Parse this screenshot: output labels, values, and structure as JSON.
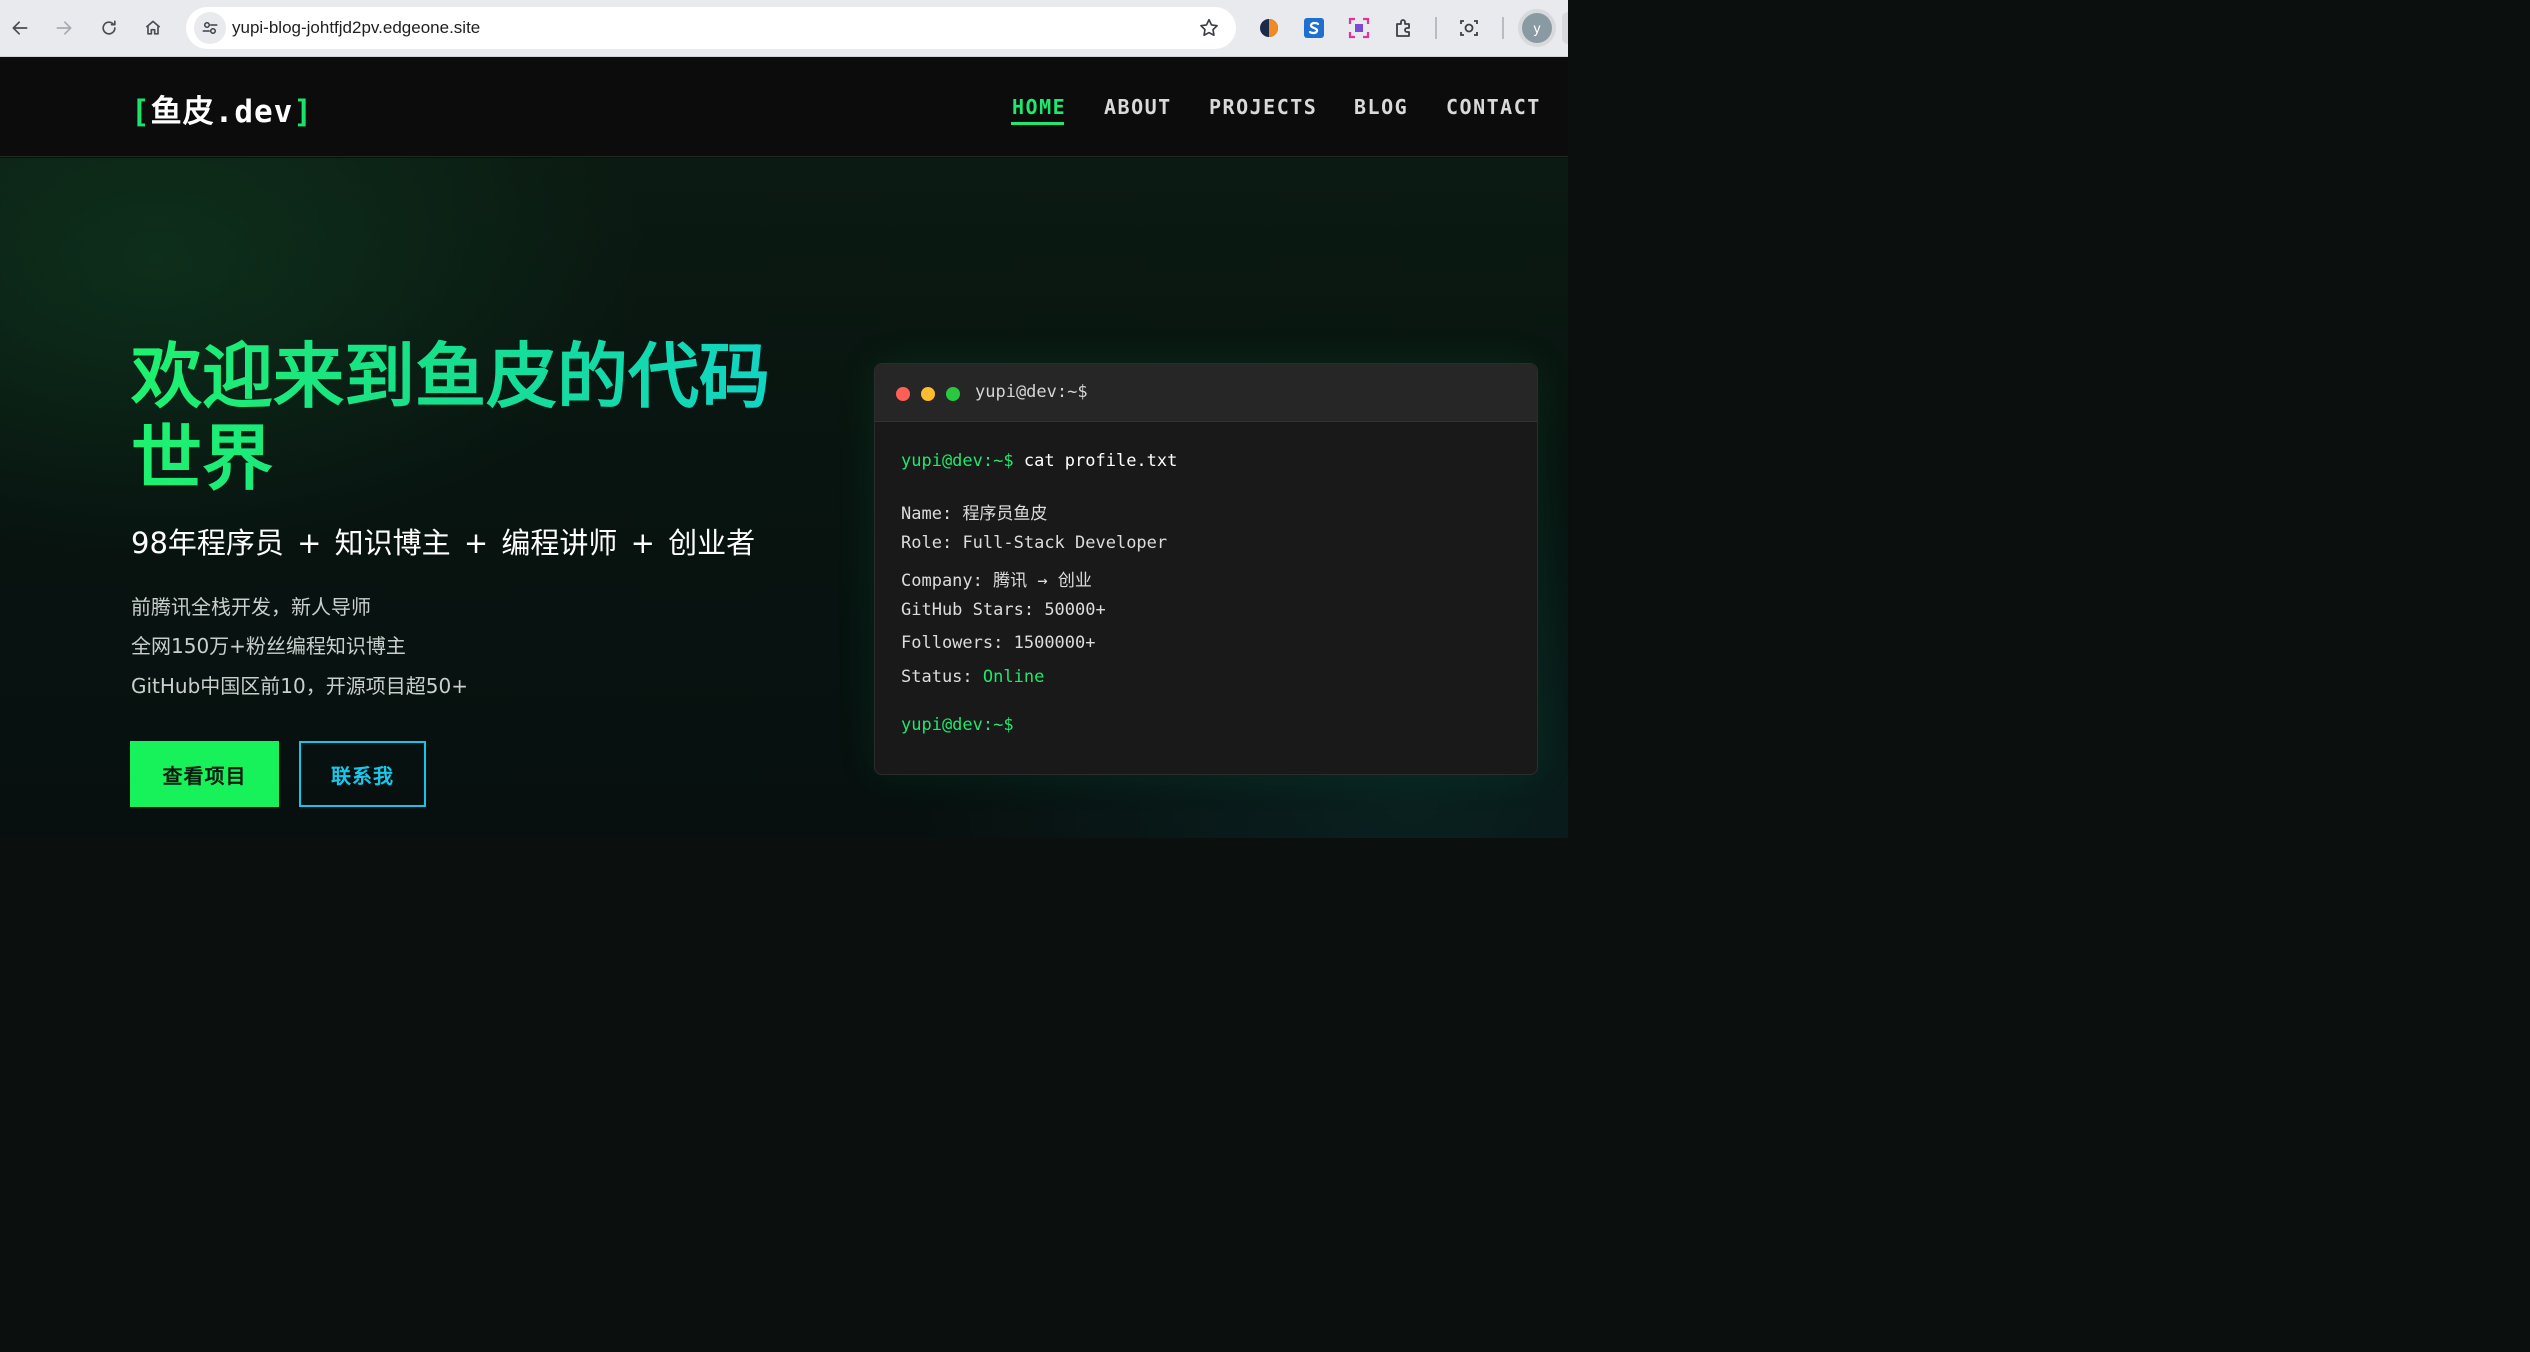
{
  "browser": {
    "url": "yupi-blog-johtfjd2pv.edgeone.site",
    "avatar_letter": "y"
  },
  "header": {
    "logo_open": "[",
    "logo_text": "鱼皮.dev",
    "logo_close": "]",
    "nav": [
      {
        "label": "HOME",
        "active": true
      },
      {
        "label": "ABOUT",
        "active": false
      },
      {
        "label": "PROJECTS",
        "active": false
      },
      {
        "label": "BLOG",
        "active": false
      },
      {
        "label": "CONTACT",
        "active": false
      }
    ]
  },
  "hero": {
    "title_line1": "欢迎来到鱼皮的代码",
    "title_line2": "世界",
    "subtitle": "98年程序员 + 知识博主 + 编程讲师 + 创业者",
    "descriptions": [
      "前腾讯全栈开发，新人导师",
      "全网150万+粉丝编程知识博主",
      "GitHub中国区前10，开源项目超50+"
    ],
    "primary_button": "查看项目",
    "secondary_button": "联系我"
  },
  "terminal": {
    "title": "yupi@dev:~$",
    "prompt": "yupi@dev:~$",
    "command": "cat profile.txt",
    "lines": [
      {
        "key": "Name:",
        "value": "程序员鱼皮"
      },
      {
        "key": "Role:",
        "value": "Full-Stack Developer"
      },
      {
        "key": "Company:",
        "value": "腾讯 → 创业"
      },
      {
        "key": "GitHub Stars:",
        "value": "50000+"
      },
      {
        "key": "Followers:",
        "value": "1500000+"
      },
      {
        "key": "Status:",
        "value": "Online"
      }
    ],
    "final_prompt": "yupi@dev:~$"
  },
  "colors": {
    "accent_green": "#1ee86f",
    "accent_cyan": "#13c6e8",
    "terminal_bg": "#191919"
  }
}
